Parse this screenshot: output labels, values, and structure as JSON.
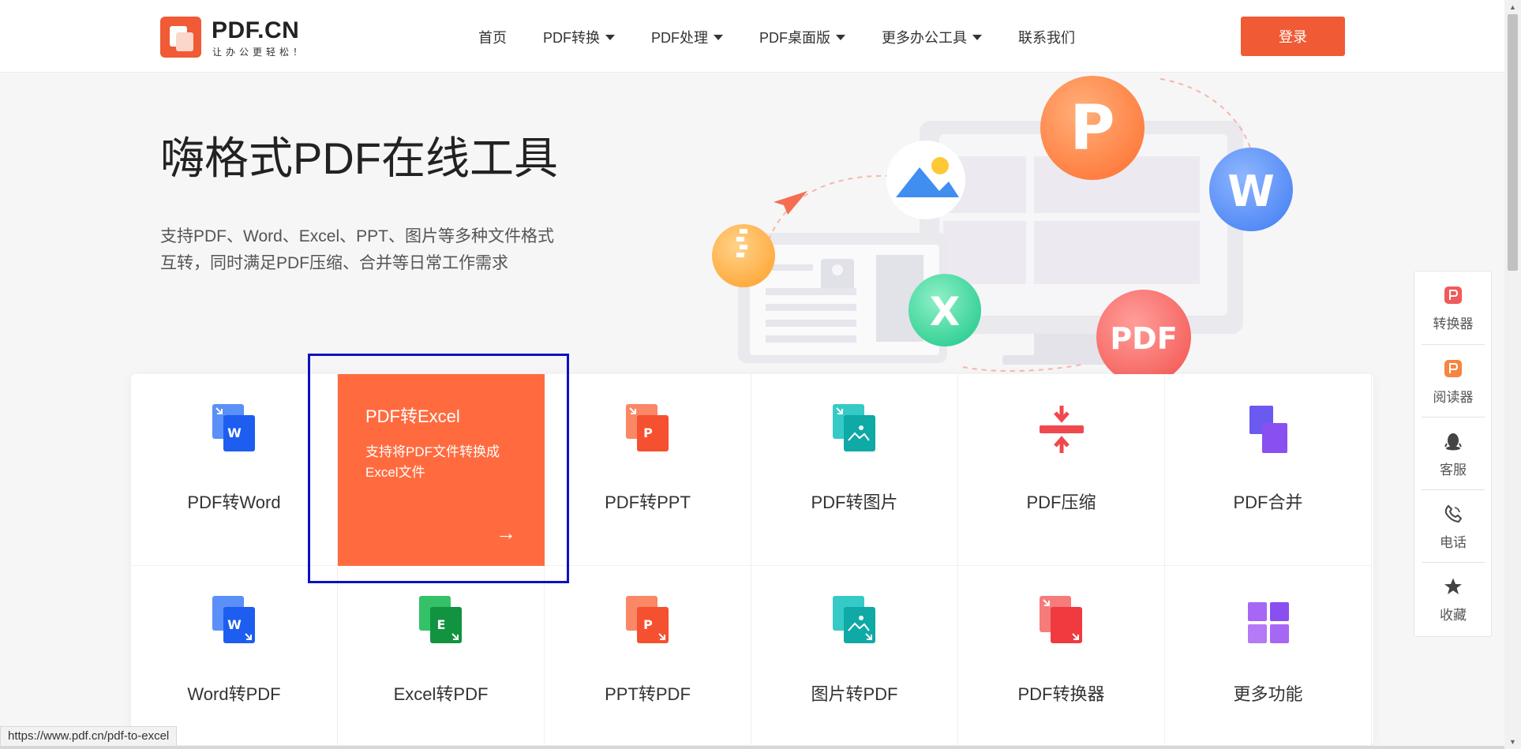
{
  "header": {
    "logo": {
      "name": "PDF.CN",
      "slogan": "让办公更轻松！"
    },
    "nav": [
      {
        "label": "首页",
        "dropdown": false
      },
      {
        "label": "PDF转换",
        "dropdown": true
      },
      {
        "label": "PDF处理",
        "dropdown": true
      },
      {
        "label": "PDF桌面版",
        "dropdown": true
      },
      {
        "label": "更多办公工具",
        "dropdown": true
      },
      {
        "label": "联系我们",
        "dropdown": false
      }
    ],
    "login_label": "登录"
  },
  "hero": {
    "title": "嗨格式PDF在线工具",
    "desc_line1": "支持PDF、Word、Excel、PPT、图片等多种文件格式",
    "desc_line2": "互转，同时满足PDF压缩、合并等日常工作需求",
    "badges": {
      "p": "P",
      "w": "W",
      "x": "X",
      "pdf": "PDF"
    }
  },
  "tools": [
    {
      "label": "PDF转Word",
      "icon": "pdf-to-word-icon",
      "letter": "W",
      "color": "#2f6df6"
    },
    {
      "label": "PDF转Excel",
      "icon": "pdf-to-excel-icon",
      "active": true,
      "desc": "支持将PDF文件转换成Excel文件",
      "arrow": "→"
    },
    {
      "label": "PDF转PPT",
      "icon": "pdf-to-ppt-icon",
      "letter": "P",
      "color": "#f5502f"
    },
    {
      "label": "PDF转图片",
      "icon": "pdf-to-image-icon",
      "color": "#13b3b0"
    },
    {
      "label": "PDF压缩",
      "icon": "compress-icon",
      "color": "#f0484f"
    },
    {
      "label": "PDF合并",
      "icon": "merge-icon",
      "color": "#7a4fea"
    },
    {
      "label": "Word转PDF",
      "icon": "word-to-pdf-icon",
      "letter": "W",
      "color": "#2f6df6"
    },
    {
      "label": "Excel转PDF",
      "icon": "excel-to-pdf-icon",
      "letter": "E",
      "color": "#17a84b"
    },
    {
      "label": "PPT转PDF",
      "icon": "ppt-to-pdf-icon",
      "letter": "P",
      "color": "#f5502f"
    },
    {
      "label": "图片转PDF",
      "icon": "image-to-pdf-icon",
      "color": "#13b3b0"
    },
    {
      "label": "PDF转换器",
      "icon": "converter-icon",
      "color": "#f0484f"
    },
    {
      "label": "更多功能",
      "icon": "more-functions-icon",
      "color": "#8a4ff0"
    }
  ],
  "sidebar": [
    {
      "label": "转换器",
      "icon": "converter-app-icon"
    },
    {
      "label": "阅读器",
      "icon": "reader-app-icon"
    },
    {
      "label": "客服",
      "icon": "qq-icon"
    },
    {
      "label": "电话",
      "icon": "phone-icon"
    },
    {
      "label": "收藏",
      "icon": "star-icon"
    }
  ],
  "status_url": "https://www.pdf.cn/pdf-to-excel",
  "colors": {
    "brand": "#f05a35",
    "active_card": "#ff6b3f",
    "highlight": "#0c11c2"
  }
}
